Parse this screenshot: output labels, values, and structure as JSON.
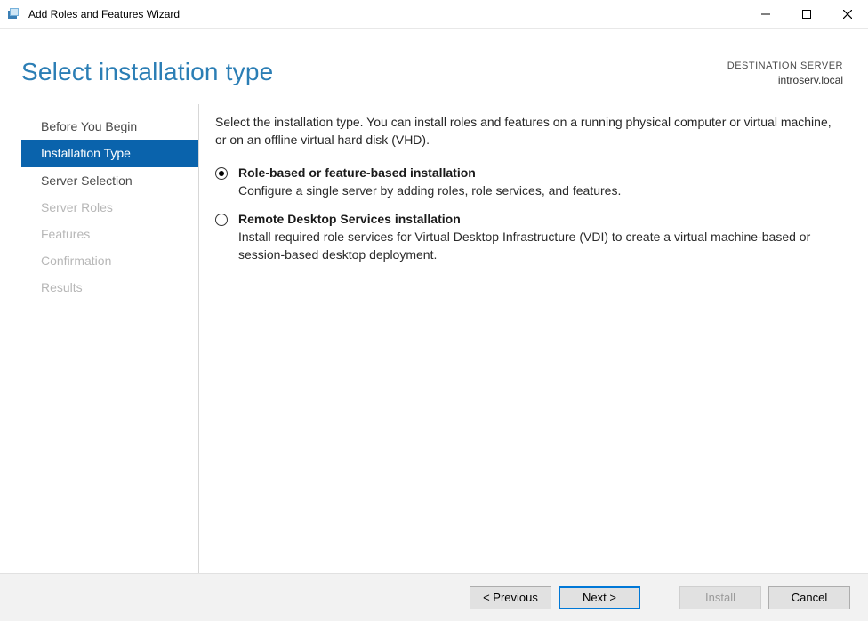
{
  "titlebar": {
    "title": "Add Roles and Features Wizard"
  },
  "header": {
    "page_title": "Select installation type",
    "destination_label": "DESTINATION SERVER",
    "destination_value": "introserv.local"
  },
  "sidebar": {
    "items": [
      {
        "label": "Before You Begin",
        "state": "enabled"
      },
      {
        "label": "Installation Type",
        "state": "selected"
      },
      {
        "label": "Server Selection",
        "state": "enabled"
      },
      {
        "label": "Server Roles",
        "state": "disabled"
      },
      {
        "label": "Features",
        "state": "disabled"
      },
      {
        "label": "Confirmation",
        "state": "disabled"
      },
      {
        "label": "Results",
        "state": "disabled"
      }
    ]
  },
  "content": {
    "intro": "Select the installation type. You can install roles and features on a running physical computer or virtual machine, or on an offline virtual hard disk (VHD).",
    "options": [
      {
        "title": "Role-based or feature-based installation",
        "desc": "Configure a single server by adding roles, role services, and features.",
        "selected": true
      },
      {
        "title": "Remote Desktop Services installation",
        "desc": "Install required role services for Virtual Desktop Infrastructure (VDI) to create a virtual machine-based or session-based desktop deployment.",
        "selected": false
      }
    ]
  },
  "footer": {
    "previous": "< Previous",
    "next": "Next >",
    "install": "Install",
    "cancel": "Cancel"
  }
}
